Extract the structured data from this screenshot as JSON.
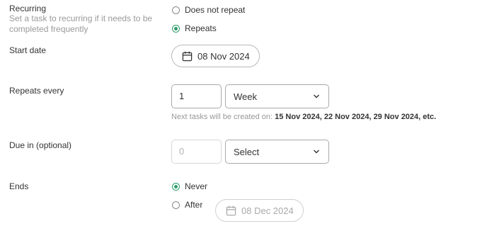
{
  "recurring": {
    "label": "Recurring",
    "description": "Set a task to recurring if it needs to be completed frequently",
    "options": [
      {
        "label": "Does not repeat",
        "selected": false
      },
      {
        "label": "Repeats",
        "selected": true
      }
    ]
  },
  "start_date": {
    "label": "Start date",
    "value": "08 Nov 2024"
  },
  "repeats_every": {
    "label": "Repeats every",
    "count": "1",
    "unit": "Week",
    "note_prefix": "Next tasks will be created on:",
    "note_dates": "15 Nov 2024, 22 Nov 2024, 29 Nov 2024, etc."
  },
  "due_in": {
    "label": "Due in (optional)",
    "placeholder": "0",
    "select_value": "Select"
  },
  "ends": {
    "label": "Ends",
    "options": [
      {
        "label": "Never",
        "selected": true
      },
      {
        "label": "After",
        "selected": false
      }
    ],
    "after_date": "08 Dec 2024"
  },
  "colors": {
    "accent": "#2f9d6a",
    "muted_text": "#9a9a9a"
  }
}
